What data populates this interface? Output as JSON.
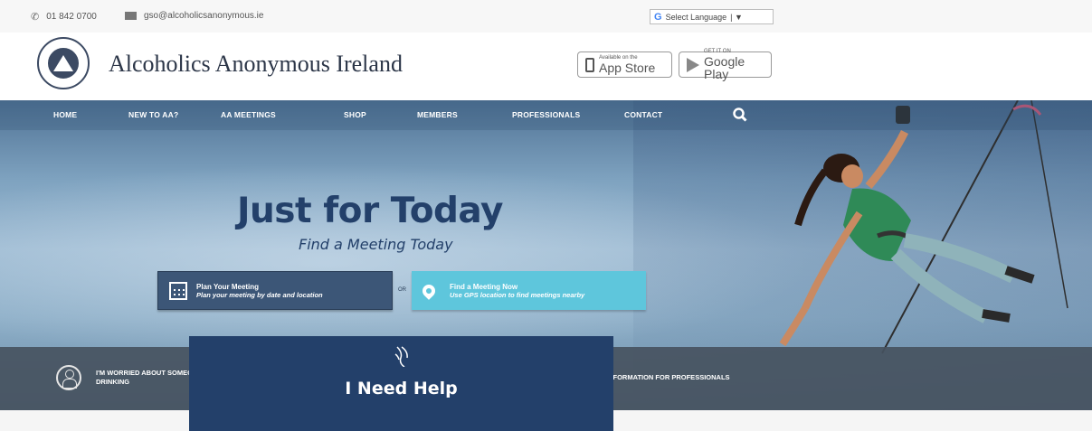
{
  "topbar": {
    "phone": "01 842 0700",
    "email": "gso@alcoholicsanonymous.ie",
    "language": "Select Language"
  },
  "header": {
    "brand": "Alcoholics Anonymous Ireland",
    "app_store_small": "Available on the",
    "app_store_big": "App Store",
    "google_play_small": "GET IT ON",
    "google_play_big": "Google Play"
  },
  "nav": {
    "items": [
      "HOME",
      "NEW TO AA?",
      "AA MEETINGS",
      "SHOP",
      "MEMBERS",
      "PROFESSIONALS",
      "CONTACT"
    ]
  },
  "hero": {
    "title": "Just for Today",
    "subtitle": "Find a Meeting Today",
    "plan_title": "Plan Your Meeting",
    "plan_sub": "Plan your meeting by date and location",
    "or": "OR",
    "find_title": "Find a Meeting Now",
    "find_sub": "Use GPS location to find meetings nearby"
  },
  "info": {
    "worried": "I'M WORRIED ABOUT SOMEONE ELSE'S DRINKING",
    "help": "I Need Help",
    "professionals": "INFORMATION FOR PROFESSIONALS"
  },
  "colors": {
    "navy": "#23406a",
    "teal": "#5ec6dc",
    "slate": "#3c5677"
  }
}
